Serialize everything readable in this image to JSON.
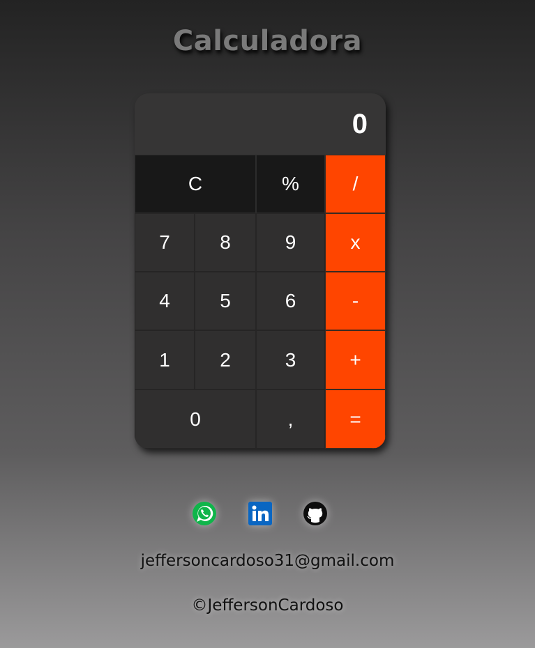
{
  "header": {
    "title": "Calculadora"
  },
  "calculator": {
    "display": "0",
    "keys": {
      "clear": "C",
      "percent": "%",
      "divide": "/",
      "seven": "7",
      "eight": "8",
      "nine": "9",
      "multiply": "x",
      "four": "4",
      "five": "5",
      "six": "6",
      "subtract": "-",
      "one": "1",
      "two": "2",
      "three": "3",
      "add": "+",
      "zero": "0",
      "decimal": ",",
      "equals": "="
    },
    "colors": {
      "operator": "#ff4500",
      "function": "#181818",
      "number": "#302f2f",
      "display": "#363535"
    }
  },
  "social": {
    "icons": [
      "whatsapp-icon",
      "linkedin-icon",
      "github-icon"
    ]
  },
  "footer": {
    "email": "jeffersoncardoso31@gmail.com",
    "copyright": "©JeffersonCardoso"
  }
}
